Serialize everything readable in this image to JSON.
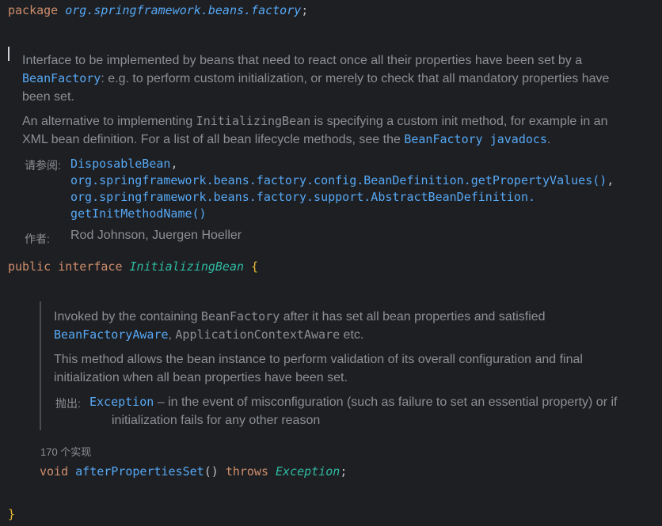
{
  "package_line": {
    "keyword": "package",
    "name": "org.springframework.beans.factory",
    "semicolon": ";"
  },
  "class_doc": {
    "p1_a": "Interface to be implemented by beans that need to react once all their properties have been set by a",
    "p1_link": "BeanFactory",
    "p1_b": ": e.g. to perform custom initialization, or merely to check that all mandatory properties have",
    "p1_c": "been set.",
    "p2_a": "An alternative to implementing ",
    "p2_code": "InitializingBean",
    "p2_b": " is specifying a custom init method, for example in an",
    "p2_c": "XML bean definition. For a list of all bean lifecycle methods, see the ",
    "p2_link1": "BeanFactory",
    "p2_link2": "javadocs",
    "p2_end": ".",
    "see_label": "请参阅:",
    "see_items": [
      "DisposableBean",
      "org.springframework.beans.factory.config.BeanDefinition.getPropertyValues()",
      "org.springframework.beans.factory.support.AbstractBeanDefinition.",
      "getInitMethodName()"
    ],
    "see_comma1": ",",
    "see_comma2": ",",
    "author_label": "作者:",
    "author_value": "Rod Johnson, Juergen Hoeller"
  },
  "interface_line": {
    "kw_public": "public",
    "kw_interface": "interface",
    "name": "InitializingBean",
    "open_brace": "{"
  },
  "method_doc": {
    "p1_a": "Invoked by the containing ",
    "p1_code": "BeanFactory",
    "p1_b": " after it has set all bean properties and satisfied",
    "p1_link": "BeanFactoryAware",
    "p1_c": ", ",
    "p1_code2": "ApplicationContextAware",
    "p1_d": " etc.",
    "p2_a": "This method allows the bean instance to perform validation of its overall configuration and final",
    "p2_b": "initialization when all bean properties have been set.",
    "throws_label": "抛出:",
    "throws_link": "Exception",
    "throws_text_a": " – in the event of misconfiguration (such as failure to set an essential property) or if",
    "throws_text_b": "initialization fails for any other reason"
  },
  "impl_hint": "170 个实现",
  "method_line": {
    "kw_void": "void",
    "name": "afterPropertiesSet",
    "parens": "()",
    "kw_throws": "throws",
    "exception": "Exception",
    "semicolon": ";"
  },
  "close_brace": "}",
  "colors": {
    "background": "#1e1f22",
    "keyword": "#cf8e6d",
    "type": "#2fbaa3",
    "link": "#56a8f5",
    "doc_text": "#8c8f94",
    "brace": "#e8ba36"
  }
}
